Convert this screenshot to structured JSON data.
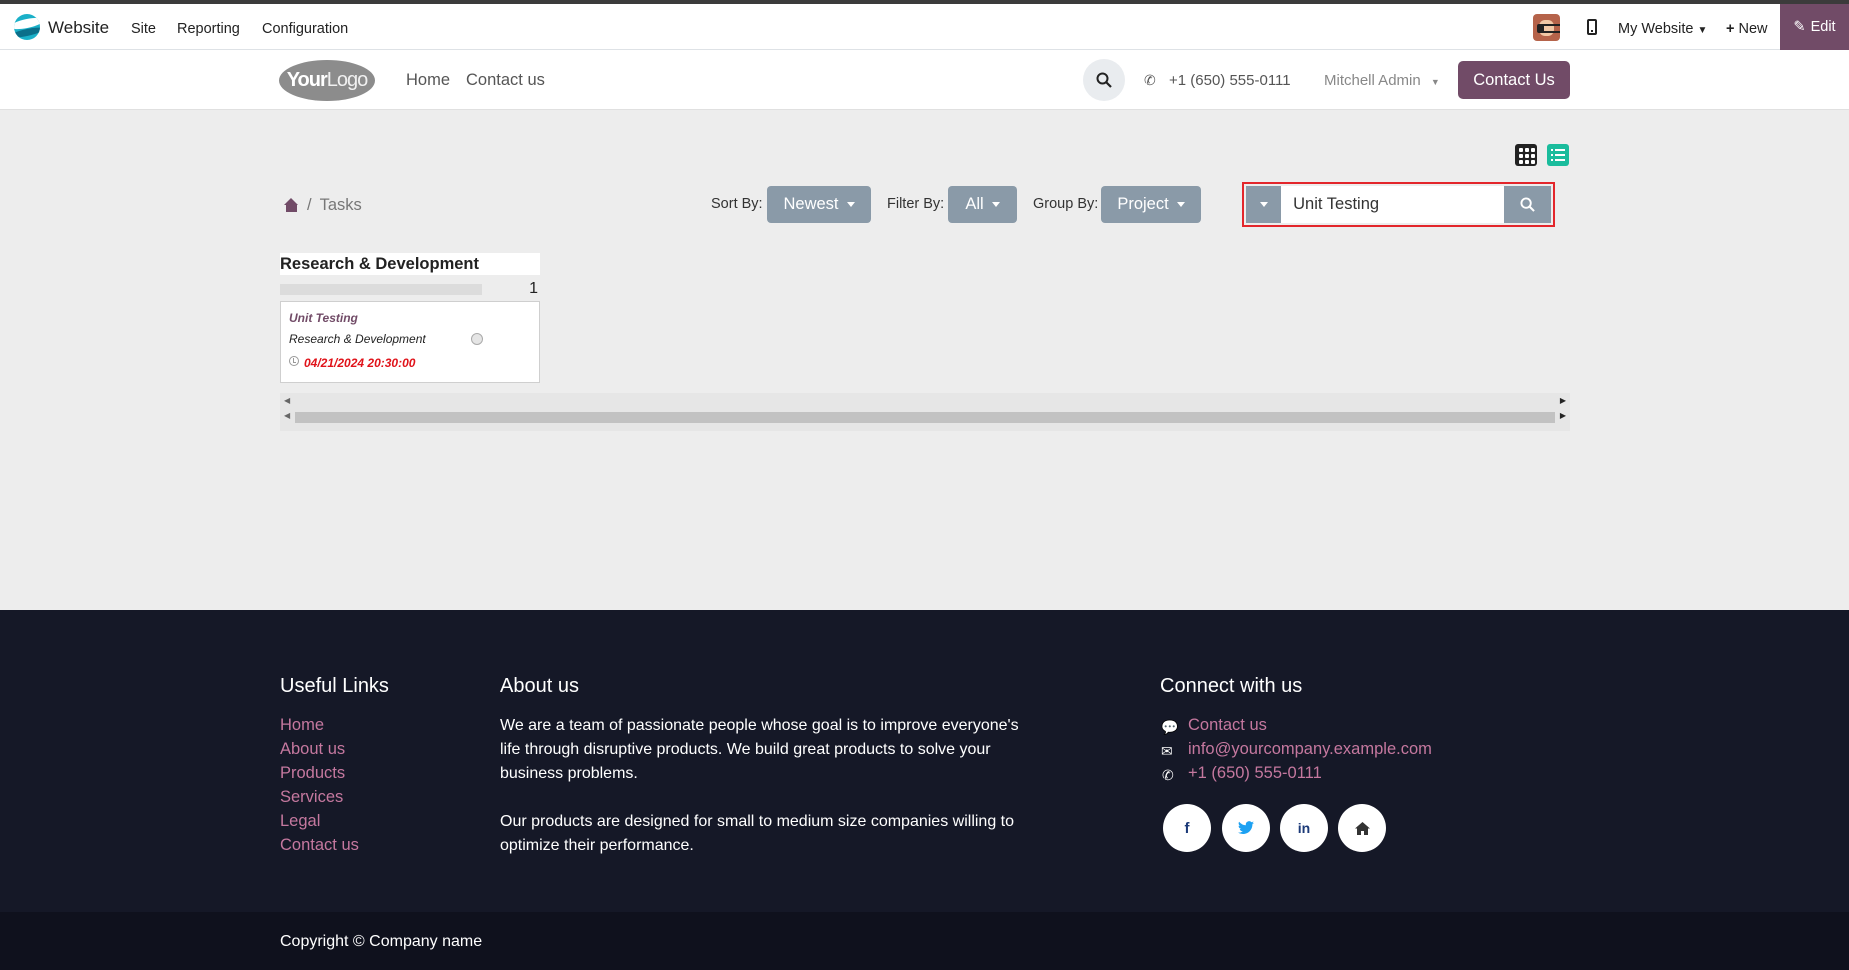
{
  "admin_bar": {
    "app_name": "Website",
    "menu": [
      "Site",
      "Reporting",
      "Configuration"
    ],
    "my_website": "My Website",
    "new_label": "New",
    "edit_label": "Edit"
  },
  "header": {
    "logo_text_1": "Your",
    "logo_text_2": "Logo",
    "nav": [
      "Home",
      "Contact us"
    ],
    "phone": "+1 (650) 555-0111",
    "user": "Mitchell Admin",
    "contact_button": "Contact Us"
  },
  "tasks": {
    "breadcrumb": "Tasks",
    "sort_label": "Sort By:",
    "sort_value": "Newest",
    "filter_label": "Filter By:",
    "filter_value": "All",
    "group_label": "Group By:",
    "group_value": "Project",
    "search_value": "Unit Testing",
    "column": {
      "title": "Research & Development",
      "count": "1",
      "card": {
        "title": "Unit Testing",
        "project": "Research & Development",
        "date": "04/21/2024 20:30:00"
      }
    }
  },
  "footer": {
    "useful_links_heading": "Useful Links",
    "useful_links": [
      "Home",
      "About us",
      "Products",
      "Services",
      "Legal",
      "Contact us"
    ],
    "about_heading": "About us",
    "about_p1_line1": "We are a team of passionate people whose goal is to improve everyone's",
    "about_p1_line2": "life through disruptive products. We build great products to solve your",
    "about_p1_line3": "business problems.",
    "about_p2_line1": "Our products are designed for small to medium size companies willing to",
    "about_p2_line2": "optimize their performance.",
    "connect_heading": "Connect with us",
    "connect_contact": "Contact us",
    "connect_email": "info@yourcompany.example.com",
    "connect_phone": "+1 (650) 555-0111",
    "social_icons": [
      "facebook-icon",
      "twitter-icon",
      "linkedin-icon",
      "home-icon"
    ],
    "copyright": "Copyright © Company name"
  },
  "colors": {
    "brand": "#714b67",
    "highlight_border": "#e3262b",
    "footer_bg": "#151827",
    "footer_link": "#c5789f",
    "date_red": "#e0131a"
  }
}
